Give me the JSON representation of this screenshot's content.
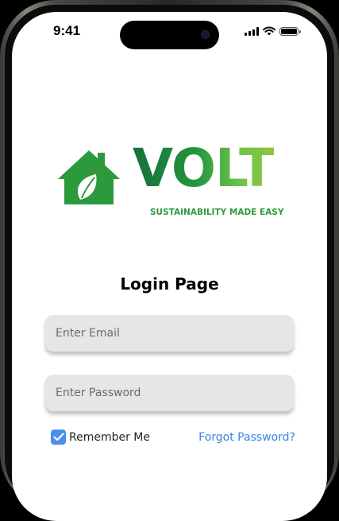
{
  "status_bar": {
    "time": "9:41"
  },
  "logo": {
    "word": "VOLT",
    "tagline": "SUSTAINABILITY MADE EASY"
  },
  "page": {
    "title": "Login Page"
  },
  "form": {
    "email_placeholder": "Enter Email",
    "password_placeholder": "Enter Password",
    "remember_label": "Remember Me",
    "remember_checked": true,
    "forgot_label": "Forgot Password?"
  },
  "colors": {
    "brand_dark": "#17703c",
    "brand_light": "#8dc63f",
    "link": "#3d82e0",
    "checkbox": "#4a8ef0",
    "field_bg": "#e6e6e6"
  }
}
